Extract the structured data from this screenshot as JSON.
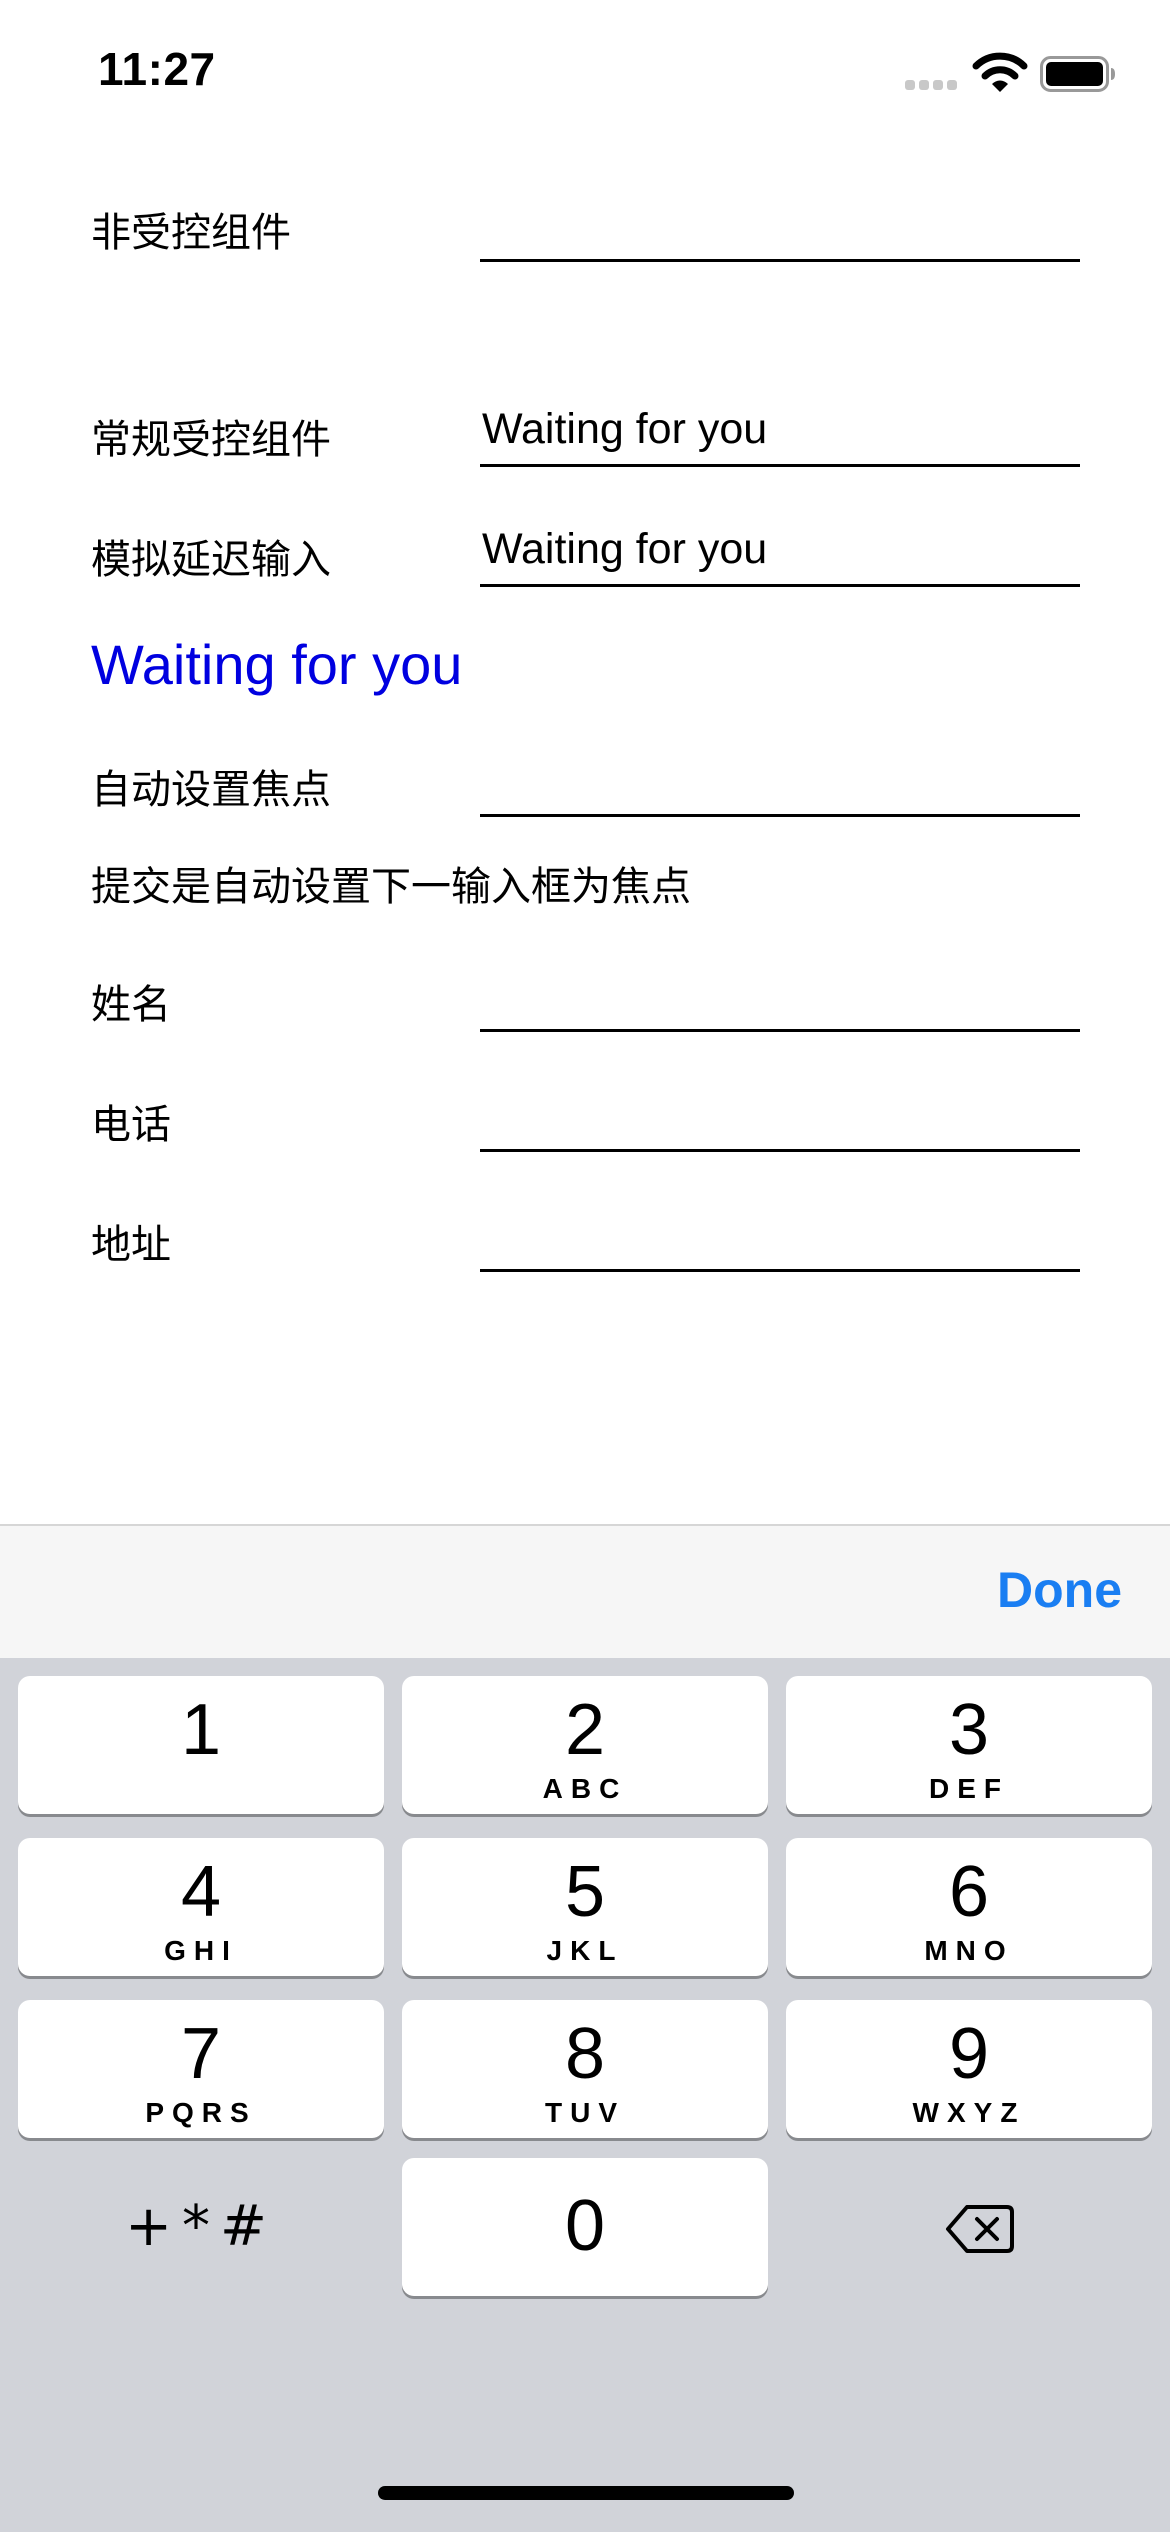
{
  "status_bar": {
    "time": "11:27",
    "icons": [
      "signal-icon",
      "wifi-icon",
      "battery-icon"
    ]
  },
  "form": {
    "uncontrolled": {
      "label": "非受控组件",
      "value": ""
    },
    "controlled": {
      "label": "常规受控组件",
      "value": "Waiting for you"
    },
    "debounced": {
      "label": "模拟延迟输入",
      "value": "Waiting for you"
    },
    "mirror_text": "Waiting for you",
    "autofocus": {
      "label": "自动设置焦点",
      "value": ""
    },
    "submit_hint": "提交是自动设置下一输入框为焦点",
    "name": {
      "label": "姓名",
      "value": ""
    },
    "phone": {
      "label": "电话",
      "value": ""
    },
    "address": {
      "label": "地址",
      "value": ""
    }
  },
  "accessory_bar": {
    "done_label": "Done"
  },
  "keypad": {
    "keys": [
      {
        "digit": "1",
        "letters": ""
      },
      {
        "digit": "2",
        "letters": "ABC"
      },
      {
        "digit": "3",
        "letters": "DEF"
      },
      {
        "digit": "4",
        "letters": "GHI"
      },
      {
        "digit": "5",
        "letters": "JKL"
      },
      {
        "digit": "6",
        "letters": "MNO"
      },
      {
        "digit": "7",
        "letters": "PQRS"
      },
      {
        "digit": "8",
        "letters": "TUV"
      },
      {
        "digit": "9",
        "letters": "WXYZ"
      },
      {
        "digit": "0",
        "letters": ""
      }
    ],
    "symbols_label": "+*#",
    "delete_icon": "backspace-icon"
  },
  "colors": {
    "accent": "#1a7ef2",
    "mirror_text": "#0000e0",
    "keypad_background": "#d1d3d9",
    "accessory_background": "#f6f6f6"
  }
}
